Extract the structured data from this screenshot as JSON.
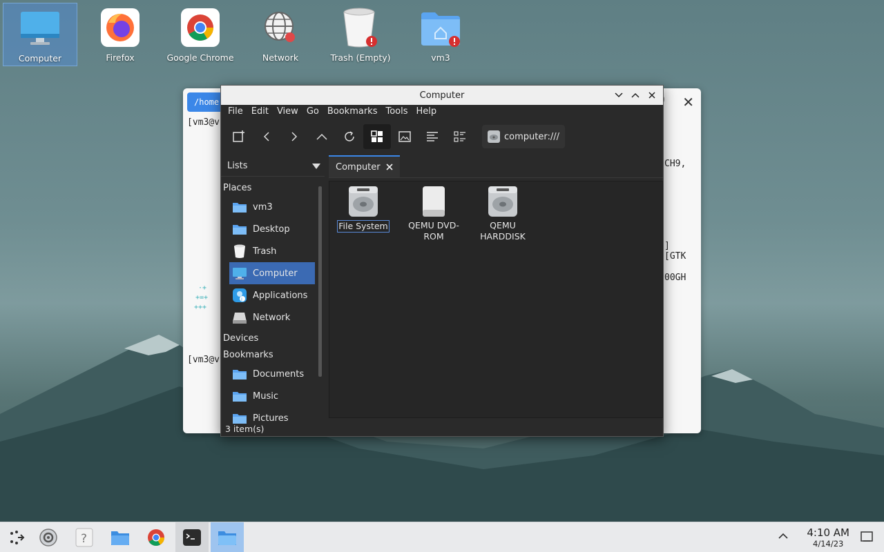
{
  "desktop": {
    "icons": [
      {
        "label": "Computer",
        "icon": "computer-icon"
      },
      {
        "label": "Firefox",
        "icon": "firefox-icon"
      },
      {
        "label": "Google Chrome",
        "icon": "chrome-icon"
      },
      {
        "label": "Network",
        "icon": "network-icon"
      },
      {
        "label": "Trash (Empty)",
        "icon": "trash-icon"
      },
      {
        "label": "vm3",
        "icon": "home-folder-icon"
      }
    ]
  },
  "terminal": {
    "tab_label": "/home",
    "lines": [
      "[vm3@v",
      "[vm3@v"
    ],
    "right_fragments": [
      "CH9,",
      "]",
      "[GTK",
      "00GH"
    ],
    "tail": "0"
  },
  "file_manager": {
    "title": "Computer",
    "menu": [
      "File",
      "Edit",
      "View",
      "Go",
      "Bookmarks",
      "Tools",
      "Help"
    ],
    "location": "computer:///",
    "sidebar": {
      "mode_label": "Lists",
      "places_heading": "Places",
      "places": [
        {
          "label": "vm3",
          "icon": "folder-icon"
        },
        {
          "label": "Desktop",
          "icon": "folder-icon"
        },
        {
          "label": "Trash",
          "icon": "trash-icon"
        },
        {
          "label": "Computer",
          "icon": "computer-icon",
          "selected": true
        },
        {
          "label": "Applications",
          "icon": "applications-icon"
        },
        {
          "label": "Network",
          "icon": "network-drive-icon"
        }
      ],
      "devices_heading": "Devices",
      "bookmarks_heading": "Bookmarks",
      "bookmarks": [
        {
          "label": "Documents",
          "icon": "folder-icon"
        },
        {
          "label": "Music",
          "icon": "folder-icon"
        },
        {
          "label": "Pictures",
          "icon": "folder-icon"
        }
      ]
    },
    "tab_label": "Computer",
    "files": [
      {
        "name": "File System",
        "icon": "harddisk-icon"
      },
      {
        "name": "QEMU DVD-ROM",
        "name_lines": [
          "QEMU DVD-",
          "ROM"
        ],
        "icon": "optical-drive-icon"
      },
      {
        "name": "QEMU HARDDISK",
        "name_lines": [
          "QEMU",
          "HARDDISK"
        ],
        "icon": "harddisk-icon"
      }
    ],
    "status": "3 item(s)"
  },
  "taskbar": {
    "time": "4:10 AM",
    "date": "4/14/23"
  },
  "colors": {
    "accent": "#3b87e8",
    "selection": "#3b6ab3",
    "window_bg": "#2a2a2a",
    "folder_blue": "#5ba4f0"
  }
}
